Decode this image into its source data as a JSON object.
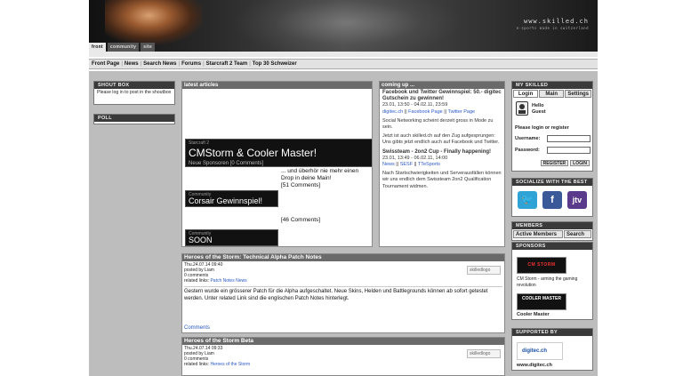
{
  "header": {
    "logo_line1": "www.skilled.ch",
    "logo_line2": "e-sports made in switzerland",
    "tabs": [
      "front",
      "community",
      "site"
    ]
  },
  "nav": [
    "Front Page",
    "News",
    "Search News",
    "Forums",
    "Starcraft 2 Team",
    "Top 30 Schweizer"
  ],
  "left": {
    "shoutbox_title": "SHOUT BOX",
    "shoutbox_text": "Please log in to post in the shoutbox",
    "poll_title": "POLL"
  },
  "latest": {
    "title": "latest articles",
    "featured": {
      "category": "Starcraft 2",
      "title": "CMStorm & Cooler Master!",
      "meta": "Neue Sponsoren [0 Comments]"
    },
    "a2": {
      "category": "Community",
      "title": "Corsair Gewinnspiel!"
    },
    "a3": {
      "category": "Community",
      "title": "SOON"
    },
    "t1": "... und überhör nie mehr einen Drop in deine Main!",
    "c1": "[51 Comments]",
    "c2": "[46 Comments]"
  },
  "coming": {
    "title": "coming up ...",
    "e1_title": "Facebook und Twitter Gewinnspiel: 50.- digitec Gutschein zu gewinnen!",
    "e1_date": "23.01, 13:50 - 04.02.11, 23:59",
    "e1_links": [
      "digitec.ch",
      "Facebook Page",
      "Twitter Page"
    ],
    "e1_text1": "Social Networking scheint derzeit gross in Mode zu sein.",
    "e1_text2": "Jetzt ist auch skilled.ch auf den Zug aufgesprungen: Uns gibts jetzt endlich auch auf Facebook und Twitter.",
    "e2_title": "Swissteam - 2on2 Cup - Finally happening!",
    "e2_date": "23.01, 13:49 - 06.02.11, 14:00",
    "e2_links": [
      "News",
      "SESF",
      "TTeSports"
    ],
    "e2_text": "Nach Startschwierigkeiten und Serverausfällen können wir uns endlich dem Swissteam 2on2 Qualification Tournament widmen."
  },
  "news": [
    {
      "title": "Heroes of the Storm: Technical Alpha Patch Notes",
      "date": "Thu.24.07.14 09:40",
      "author": "posted by Liam",
      "comments": "0 comments",
      "related_label": "related links:",
      "related": "Patch Notes News",
      "body": "Gestern wurde ein grösserer Patch für die Alpha aufgeschaltet. Neue Skins, Helden und Battlegrounds können ab sofort getestet werden. Unter related Link sind die englischen Patch Notes hinterlegt.",
      "comments_link": "Comments",
      "logo_alt": "skilledlogo"
    },
    {
      "title": "Heroes of the Storm Beta",
      "date": "Thu.24.07.14 09:33",
      "author": "posted by Liam",
      "comments": "0 comments",
      "related_label": "related links:",
      "related": "Heroes of the Storm",
      "logo_alt": "skilledlogo"
    }
  ],
  "right": {
    "my_title": "MY SKILLED",
    "tabs": [
      "Login",
      "Main",
      "Settings"
    ],
    "hello": "Hello",
    "guest": "Guest",
    "login_msg": "Please login or register",
    "username_label": "Username:",
    "password_label": "Password:",
    "register_btn": "REGISTER",
    "login_btn": "LOGIN",
    "socialize_title": "SOCIALIZE WITH THE BEST",
    "social_icons": [
      "twitter-icon",
      "facebook-icon",
      "justintv-icon"
    ],
    "members_title": "MEMBERS",
    "members_tabs": [
      "Active Members",
      "Search"
    ],
    "sponsors_title": "SPONSORS",
    "sponsor1_logo": "CM STORM",
    "sponsor1_text": "CM Storm - arming the gaming revolution",
    "sponsor2_logo": "COOLER MASTER",
    "sponsor2_text": "Cooler Master",
    "supported_title": "SUPPORTED BY",
    "supporter_logo": "digitec.ch",
    "supporter_text": "www.digitec.ch"
  },
  "colors": {
    "link": "#2a58c8",
    "panel_head": "#6a6a6a",
    "box_head": "#3a3a3a",
    "content_bg": "#bdbdbd"
  }
}
